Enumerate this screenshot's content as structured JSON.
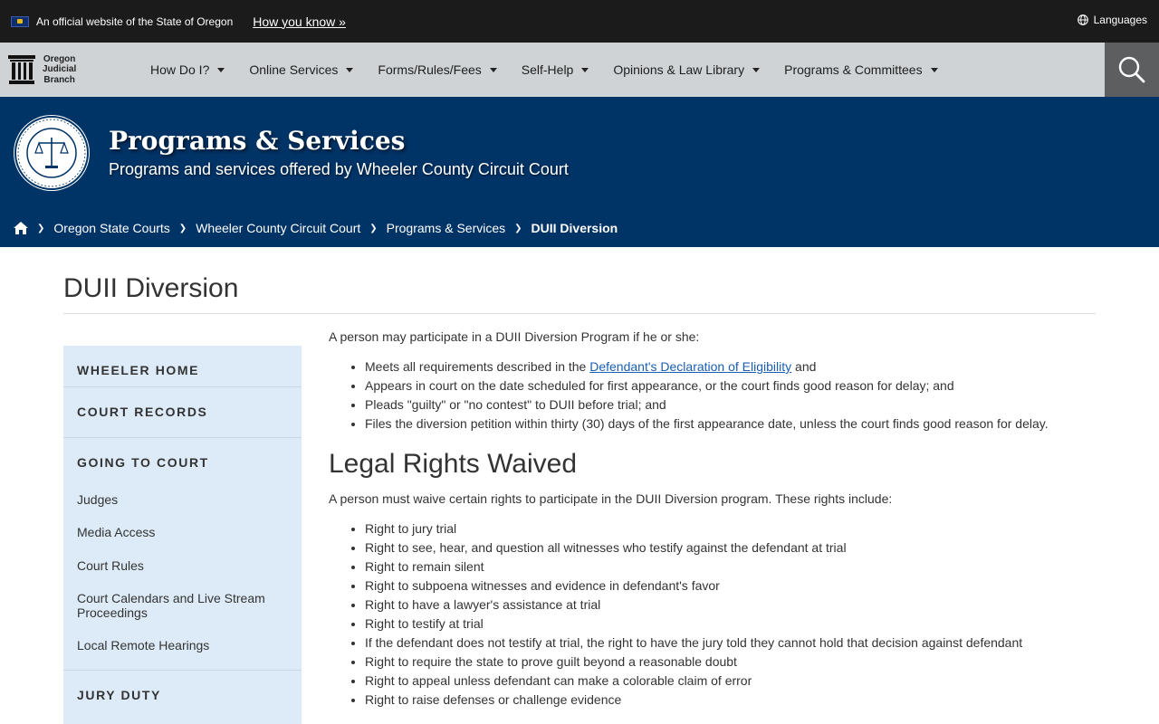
{
  "banner": {
    "official_text": "An official website of the State of Oregon",
    "how_you_know": "How you know »",
    "languages": "Languages"
  },
  "logo": {
    "line1": "Oregon",
    "line2": "Judicial",
    "line3": "Branch"
  },
  "nav": {
    "items": [
      {
        "label": "How Do I?"
      },
      {
        "label": "Online Services"
      },
      {
        "label": "Forms/Rules/Fees"
      },
      {
        "label": "Self-Help"
      },
      {
        "label": "Opinions & Law Library"
      },
      {
        "label": "Programs & Committees"
      }
    ]
  },
  "hero": {
    "title": "Programs & Services",
    "subtitle": "Programs and services offered by Wheeler County Circuit Court"
  },
  "breadcrumb": {
    "items": [
      {
        "label": "Oregon State Courts"
      },
      {
        "label": "Wheeler County Circuit Court"
      },
      {
        "label": "Programs & Services"
      },
      {
        "label": "DUII Diversion"
      }
    ]
  },
  "page": {
    "title": "DUII Diversion"
  },
  "sidebar": {
    "wheeler_home": "WHEELER HOME",
    "court_records": "COURT RECORDS",
    "going_to_court": "GOING TO COURT",
    "links": [
      "Judges",
      "Media Access",
      "Court Rules",
      "Court Calendars and Live Stream Proceedings",
      "Local Remote Hearings"
    ],
    "jury_duty": "JURY DUTY"
  },
  "content": {
    "intro": "A person may participate in a DUII Diversion Program if he or she:",
    "req1_before": "Meets all requirements described in the ",
    "req1_link": "Defendant's Declaration of Eligibility",
    "req1_after": " and",
    "requirements": [
      "Appears in court on the date scheduled for first appearance, or the court finds good reason for delay; and",
      "Pleads \"guilty\" or \"no contest\" to DUII before trial; and",
      "Files the diversion petition within thirty (30) days of the first appearance date, unless the court finds good reason for delay."
    ],
    "rights_heading": "Legal Rights Waived",
    "rights_intro": "A person must waive certain rights to participate in the DUII Diversion program. These rights include:",
    "rights": [
      "Right to jury trial",
      "Right to see, hear, and question all witnesses who testify against the defendant at trial",
      "Right to remain silent",
      "Right to subpoena witnesses and evidence in defendant's favor",
      "Right to have a lawyer's assistance at trial",
      "Right to testify at trial",
      "If the defendant does not testify at trial, the right to have the jury told they cannot hold that decision against defendant",
      "Right to require the state to prove guilt beyond a reasonable doubt",
      "Right to appeal unless defendant can make a colorable claim of error",
      "Right to raise defenses or challenge evidence"
    ]
  },
  "colors": {
    "topbar": "#1b1b1b",
    "nav_bg": "#cfd3d6",
    "hero_bg": "#003366",
    "sidebar_bg": "#dcebf7",
    "link": "#1a5fb4"
  }
}
